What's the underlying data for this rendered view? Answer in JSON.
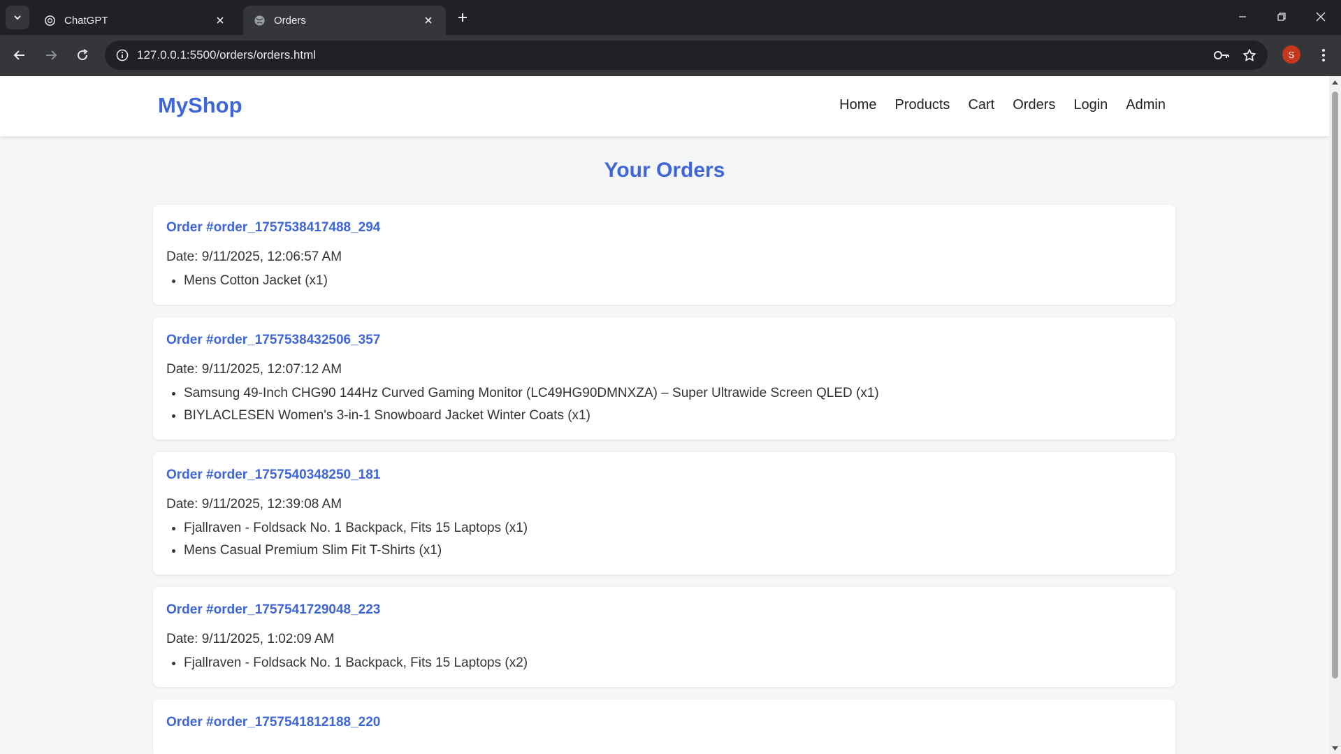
{
  "browser": {
    "tabs": [
      {
        "title": "ChatGPT",
        "active": false,
        "icon": "chatgpt-icon"
      },
      {
        "title": "Orders",
        "active": true,
        "icon": "globe-icon"
      }
    ],
    "url": "127.0.0.1:5500/orders/orders.html",
    "profile_initial": "S",
    "profile_color": "#c5361b"
  },
  "site": {
    "logo": "MyShop",
    "nav": [
      "Home",
      "Products",
      "Cart",
      "Orders",
      "Login",
      "Admin"
    ],
    "accent_color": "#3e66d8"
  },
  "page": {
    "title": "Your Orders",
    "orders": [
      {
        "id": "Order #order_1757538417488_294",
        "date": "Date: 9/11/2025, 12:06:57 AM",
        "items": [
          "Mens Cotton Jacket (x1)"
        ]
      },
      {
        "id": "Order #order_1757538432506_357",
        "date": "Date: 9/11/2025, 12:07:12 AM",
        "items": [
          "Samsung 49-Inch CHG90 144Hz Curved Gaming Monitor (LC49HG90DMNXZA) – Super Ultrawide Screen QLED (x1)",
          "BIYLACLESEN Women's 3-in-1 Snowboard Jacket Winter Coats (x1)"
        ]
      },
      {
        "id": "Order #order_1757540348250_181",
        "date": "Date: 9/11/2025, 12:39:08 AM",
        "items": [
          "Fjallraven - Foldsack No. 1 Backpack, Fits 15 Laptops (x1)",
          "Mens Casual Premium Slim Fit T-Shirts (x1)"
        ]
      },
      {
        "id": "Order #order_1757541729048_223",
        "date": "Date: 9/11/2025, 1:02:09 AM",
        "items": [
          "Fjallraven - Foldsack No. 1 Backpack, Fits 15 Laptops (x2)"
        ]
      },
      {
        "id": "Order #order_1757541812188_220",
        "date": "",
        "items": []
      }
    ]
  }
}
